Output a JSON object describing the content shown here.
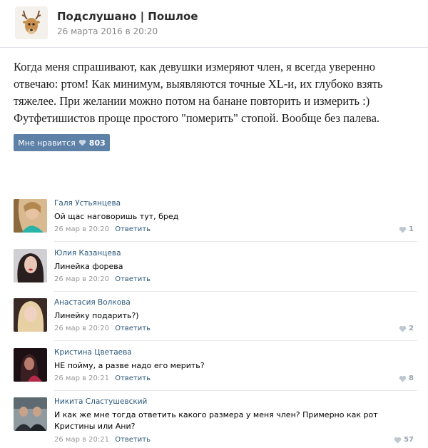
{
  "header": {
    "group_name": "Подслушано | Пошлое",
    "date": "26 марта 2016 в 20:20"
  },
  "post": {
    "lines": [
      "Когда меня спрашивают, как девушки измеряют член, я всегда уверенно",
      "отвечаю: ртом! Как минимум, выявляются точные XL-и, их глубоко взять",
      "тяжелее. При желании можно потом на банане повторить и измерить :)",
      "Футфетишистов проще простого \"померить\" стопой. Вообще без палева."
    ],
    "like_label": "Мне нравится",
    "like_count": "803"
  },
  "comments": [
    {
      "name": "Галя Устьянцева",
      "text": "Ой щас наговоришь тут, бред",
      "date": "26 мар в 20:20",
      "reply": "Ответить",
      "likes": "1"
    },
    {
      "name": "Юлия Казанцева",
      "text": "Линейка форева",
      "date": "26 мар в 20:20",
      "reply": "Ответить",
      "likes": ""
    },
    {
      "name": "Анастасия Волкова",
      "text": "Линейку подарить?)",
      "date": "26 мар в 20:20",
      "reply": "Ответить",
      "likes": "2"
    },
    {
      "name": "Кристина Цветаева",
      "text": "НЕ пойму, а разве надо его мерить?",
      "date": "26 мар в 20:21",
      "reply": "Ответить",
      "likes": "8"
    },
    {
      "name": "Никита Сластушевский",
      "text": "И как же мне тогда ответить какого размера у меня член? Примерно как рот Кристины или Ани?",
      "date": "26 мар в 20:21",
      "reply": "Ответить",
      "likes": "57"
    }
  ],
  "colors": {
    "link": "#2b587a",
    "like_button": "#5e81a8"
  }
}
